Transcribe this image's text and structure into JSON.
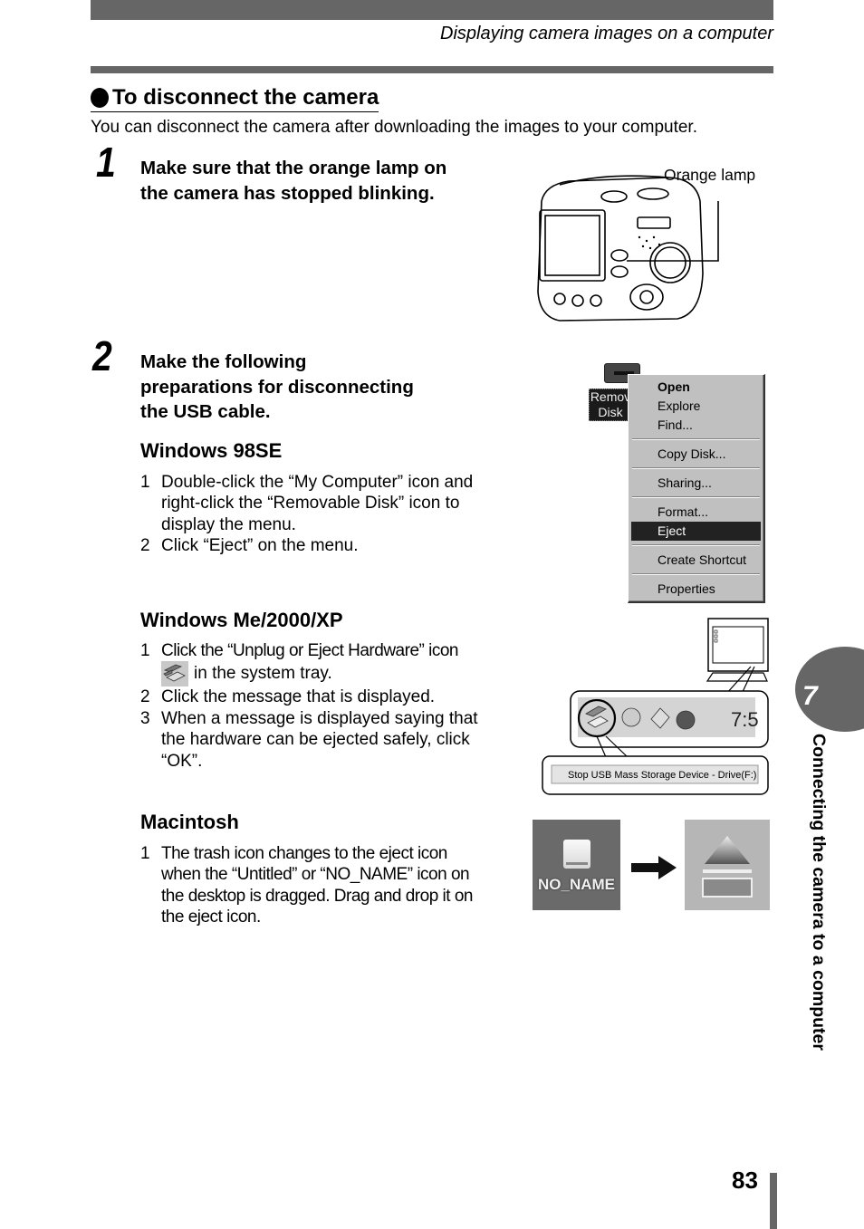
{
  "header": {
    "running_head": "Displaying camera images on a computer"
  },
  "section": {
    "title": "To disconnect the camera",
    "intro": "You can disconnect the camera after downloading the images to your computer."
  },
  "step1": {
    "number": "1",
    "heading_lines": [
      "Make sure that the orange lamp on",
      "the camera has stopped blinking."
    ],
    "figure_label": "Orange lamp"
  },
  "step2": {
    "number": "2",
    "heading_lines": [
      "Make the following",
      "preparations for disconnecting",
      "the USB cable."
    ],
    "win98": {
      "title": "Windows 98SE",
      "items": [
        {
          "n": "1",
          "text": "Double-click the “My Computer” icon and right-click the “Removable Disk” icon to display the menu."
        },
        {
          "n": "2",
          "text": "Click “Eject” on the menu."
        }
      ],
      "figure": {
        "drive_label": "Remov\nDisk",
        "menu": [
          {
            "label": "Open",
            "bold": true
          },
          {
            "label": "Explore"
          },
          {
            "label": "Find..."
          },
          {
            "sep": true
          },
          {
            "label": "Copy Disk..."
          },
          {
            "sep": true
          },
          {
            "label": "Sharing..."
          },
          {
            "sep": true
          },
          {
            "label": "Format..."
          },
          {
            "label": "Eject",
            "selected": true
          },
          {
            "sep": true
          },
          {
            "label": "Create Shortcut"
          },
          {
            "sep": true
          },
          {
            "label": "Properties"
          }
        ],
        "menu_labels": {
          "open": "Open",
          "explore": "Explore",
          "find": "Find...",
          "copy_disk": "Copy Disk...",
          "sharing": "Sharing...",
          "format": "Format...",
          "eject": "Eject",
          "create_shortcut": "Create Shortcut",
          "properties": "Properties"
        }
      }
    },
    "winxp": {
      "title": "Windows Me/2000/XP",
      "item1_a": "Click the “Unplug or Eject Hardware” icon",
      "item1_b": "in the system tray.",
      "item2": "Click the message that is displayed.",
      "item3": "When a message is displayed saying that the hardware can be ejected safely, click “OK”.",
      "figure": {
        "clock_text": "7:5",
        "popup_text": "Stop USB Mass Storage Device - Drive(F:)"
      }
    },
    "mac": {
      "title": "Macintosh",
      "item1": "The trash icon changes to the eject icon when the “Untitled” or “NO_NAME” icon on the desktop is dragged. Drag and drop it on the eject icon.",
      "figure": {
        "volume_name": "NO_NAME"
      }
    }
  },
  "chapter_tab": {
    "number": "7",
    "title": "Connecting the camera to a computer"
  },
  "footer": {
    "page_number": "83"
  },
  "nums": {
    "one": "1",
    "two": "2",
    "three": "3"
  }
}
